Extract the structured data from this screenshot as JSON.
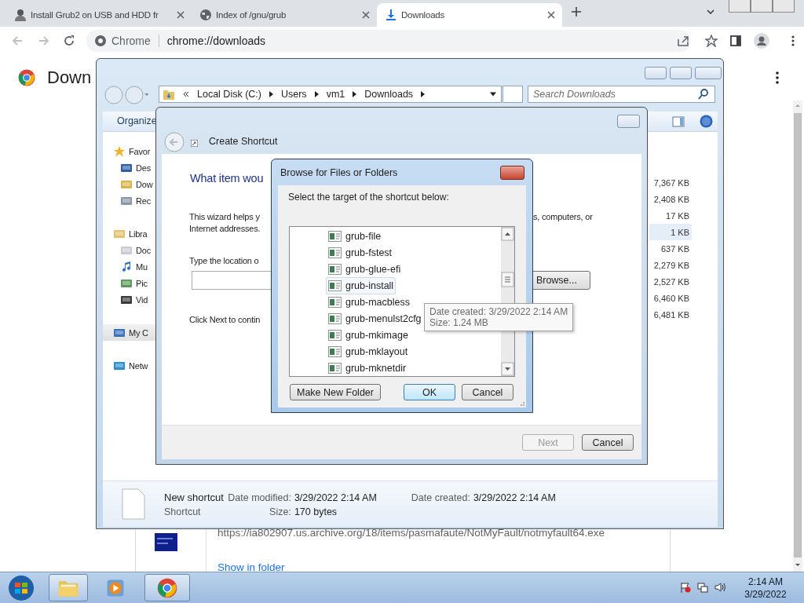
{
  "browser": {
    "tabs": [
      {
        "title": "Install Grub2 on USB and HDD fr",
        "kind": "person",
        "selected": false
      },
      {
        "title": "Index of /gnu/grub",
        "kind": "globe",
        "selected": false
      },
      {
        "title": "Downloads",
        "kind": "download",
        "selected": true
      }
    ],
    "omnibox": {
      "label": "Chrome",
      "url": "chrome://downloads"
    }
  },
  "downloads_page": {
    "heading": "Down",
    "item": {
      "url": "https://ia802907.us.archive.org/18/items/pasmafaute/NotMyFault/notmyfault64.exe",
      "link": "Show in folder"
    }
  },
  "explorer": {
    "breadcrumb": [
      "Local Disk (C:)",
      "Users",
      "vm1",
      "Downloads"
    ],
    "search_placeholder": "Search Downloads",
    "toolbar": "Organize",
    "nav": [
      {
        "label": "Favor",
        "kind": "star",
        "selected": false,
        "children": [
          {
            "label": "Des",
            "kind": "desktop"
          },
          {
            "label": "Dow",
            "kind": "downloads"
          },
          {
            "label": "Rec",
            "kind": "recent"
          }
        ]
      },
      {
        "label": "Libra",
        "kind": "library",
        "selected": false,
        "children": [
          {
            "label": "Doc",
            "kind": "document"
          },
          {
            "label": "Mu",
            "kind": "music"
          },
          {
            "label": "Pic",
            "kind": "picture"
          },
          {
            "label": "Vid",
            "kind": "video"
          }
        ]
      },
      {
        "label": "My C",
        "kind": "computer",
        "selected": true
      },
      {
        "label": "Netw",
        "kind": "network",
        "selected": false
      }
    ],
    "sizes": [
      {
        "text": "7,367 KB",
        "selected": false
      },
      {
        "text": "2,408 KB",
        "selected": false
      },
      {
        "text": "17 KB",
        "selected": false
      },
      {
        "text": "1 KB",
        "selected": true
      },
      {
        "text": "637 KB",
        "selected": false
      },
      {
        "text": "2,279 KB",
        "selected": false
      },
      {
        "text": "2,527 KB",
        "selected": false
      },
      {
        "text": "6,460 KB",
        "selected": false
      },
      {
        "text": "6,481 KB",
        "selected": false
      }
    ],
    "details": {
      "name": "New shortcut",
      "type": "Shortcut",
      "fields": [
        {
          "label": "Date modified:",
          "value": "3/29/2022 2:14 AM"
        },
        {
          "label": "Date created:",
          "value": "3/29/2022 2:14 AM"
        },
        {
          "label": "Size:",
          "value": "170 bytes"
        }
      ]
    }
  },
  "wizard": {
    "title": "Create Shortcut",
    "heading": "What item wou",
    "intro": "This wizard helps y",
    "intro_right": "s, computers, or",
    "intro_line2": "Internet addresses.",
    "location_label": "Type the location o",
    "browse_button": "Browse...",
    "next_hint": "Click Next to contin",
    "buttons": [
      {
        "label": "Next",
        "disabled": true
      },
      {
        "label": "Cancel",
        "disabled": false
      }
    ]
  },
  "browse_dialog": {
    "title": "Browse for Files or Folders",
    "prompt": "Select the target of the shortcut below:",
    "items": [
      {
        "name": "grub-file",
        "selected": false
      },
      {
        "name": "grub-fstest",
        "selected": false
      },
      {
        "name": "grub-glue-efi",
        "selected": false
      },
      {
        "name": "grub-install",
        "selected": true
      },
      {
        "name": "grub-macbless",
        "selected": false
      },
      {
        "name": "grub-menulst2cfg",
        "selected": false
      },
      {
        "name": "grub-mkimage",
        "selected": false
      },
      {
        "name": "grub-mklayout",
        "selected": false
      },
      {
        "name": "grub-mknetdir",
        "selected": false
      }
    ],
    "tooltip": [
      "Date created: 3/29/2022 2:14 AM",
      "Size: 1.24 MB"
    ],
    "buttons": [
      {
        "label": "Make New Folder",
        "default": false
      },
      {
        "label": "OK",
        "default": true
      },
      {
        "label": "Cancel",
        "default": false
      }
    ]
  },
  "taskbar": {
    "apps": [
      {
        "kind": "explorer",
        "active": true
      },
      {
        "kind": "media",
        "active": false
      },
      {
        "kind": "chrome",
        "active": true
      }
    ],
    "time": "2:14 AM",
    "date": "3/29/2022"
  }
}
